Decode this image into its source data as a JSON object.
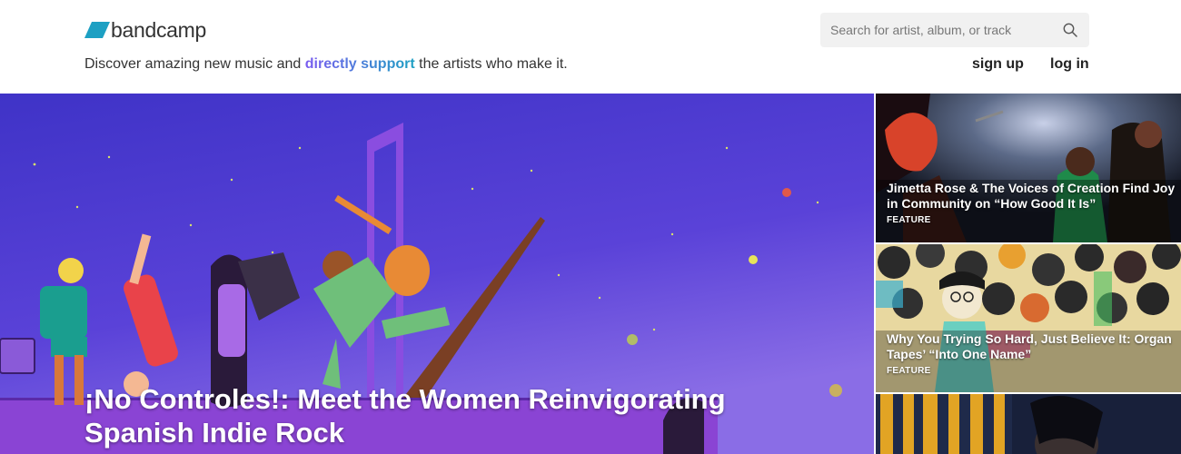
{
  "brand": {
    "name": "bandcamp",
    "logo_color": "#1da0c3"
  },
  "tagline": {
    "before": "Discover amazing new music and ",
    "highlight": "directly support",
    "after": " the artists who make it."
  },
  "search": {
    "placeholder": "Search for artist, album, or track",
    "icon": "search-icon"
  },
  "nav": {
    "signup_label": "sign up",
    "login_label": "log in"
  },
  "hero": {
    "title": "¡No Controles!: Meet the Women Reinvigorating Spanish Indie Rock",
    "background_color": "#5a3fd6"
  },
  "side_stories": [
    {
      "title": "Jimetta Rose & The Voices of Creation Find Joy in Community on “How Good It Is”",
      "tag": "FEATURE"
    },
    {
      "title": "Why You Trying So Hard, Just Believe It: Organ Tapes’ “Into One Name”",
      "tag": "FEATURE"
    },
    {
      "title": "",
      "tag": ""
    }
  ]
}
